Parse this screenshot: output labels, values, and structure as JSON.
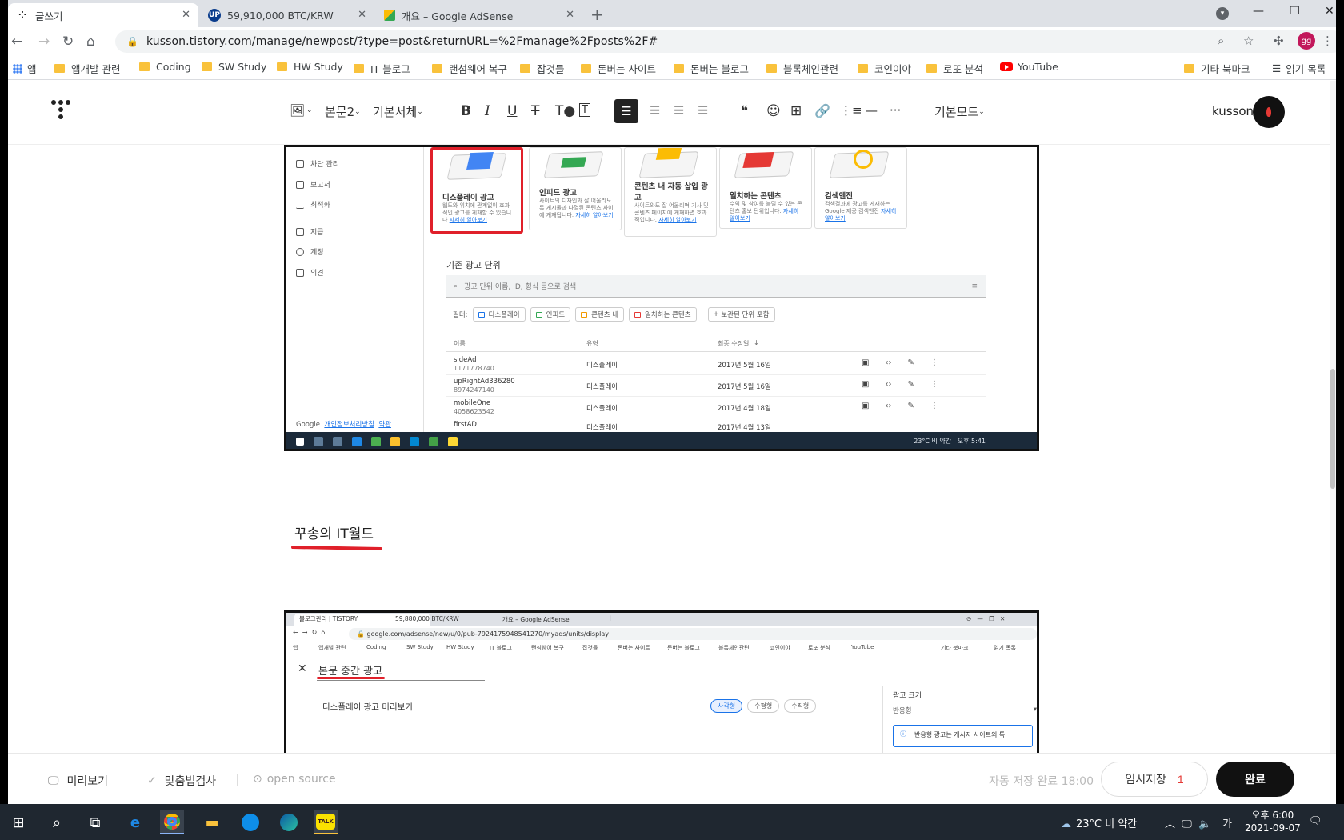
{
  "browser": {
    "tabs": [
      {
        "title": "글쓰기",
        "active": true
      },
      {
        "title": "59,910,000 BTC/KRW",
        "active": false
      },
      {
        "title": "개요 – Google AdSense",
        "active": false
      }
    ],
    "url": "kusson.tistory.com/manage/newpost/?type=post&returnURL=%2Fmanage%2Fposts%2F#",
    "profile_initials": "gg",
    "bookmarks": [
      "앱",
      "앱개발 관련",
      "Coding",
      "SW Study",
      "HW Study",
      "IT 블로그",
      "랜섬웨어 복구",
      "잡것들",
      "돈버는 사이트",
      "돈버는 블로그",
      "블록체인관련",
      "코인이야",
      "로또 분석",
      "YouTube"
    ],
    "bookmarks_right": [
      "기타 북마크",
      "읽기 목록"
    ]
  },
  "editor": {
    "toolbar": {
      "paragraph_style": "본문2",
      "font": "기본서체",
      "bold": "B",
      "italic": "I",
      "underline": "U",
      "strike": "T",
      "mode": "기본모드"
    },
    "user": {
      "name": "kusson"
    },
    "heading_text": "꾸송의 IT월드"
  },
  "screenshot1": {
    "sidebar": [
      "차단 관리",
      "보고서",
      "최적화",
      "지급",
      "계정",
      "의견"
    ],
    "footer": {
      "google": "Google",
      "privacy": "개인정보처리방침",
      "terms": "약관"
    },
    "cards": [
      {
        "title": "디스플레이 광고",
        "desc": "웹도와 위치에 관계없이 효과적인 광고를 게재할 수 있습니다",
        "link": "자세히 알아보기"
      },
      {
        "title": "인피드 광고",
        "desc": "사이트의 디자인과 잘 어울리도록 게시물과 나열된 콘텐츠 사이에 게재됩니다.",
        "link": "자세히 알아보기"
      },
      {
        "title": "콘텐츠 내 자동 삽입 광고",
        "desc": "사이트와도 잘 어울리며 기사 및 콘텐츠 페이지에 게재하면 효과적입니다.",
        "link": "자세히 알아보기"
      },
      {
        "title": "일치하는 콘텐츠",
        "desc": "수익 및 참여를 늘릴 수 있는 콘텐츠 홍보 단위입니다.",
        "link": "자세히 알아보기"
      },
      {
        "title": "검색엔진",
        "desc": "검색결과에 광고를 게재하는 Google 제공 검색엔진",
        "link": "자세히 알아보기"
      }
    ],
    "section_title": "기존 광고 단위",
    "search_placeholder": "광고 단위 이름, ID, 형식 등으로 검색",
    "filter_label": "필터:",
    "filters": [
      "디스플레이",
      "인피드",
      "콘텐츠 내",
      "일치하는 콘텐츠"
    ],
    "filter_add": "보관된 단위 포함",
    "columns": [
      "이름",
      "유형",
      "최종 수정일"
    ],
    "rows": [
      {
        "name": "sideAd",
        "id": "1171778740",
        "type": "디스플레이",
        "date": "2017년 5월 16일"
      },
      {
        "name": "upRightAd336280",
        "id": "8974247140",
        "type": "디스플레이",
        "date": "2017년 5월 16일"
      },
      {
        "name": "mobileOne",
        "id": "4058623542",
        "type": "디스플레이",
        "date": "2017년 4월 18일"
      },
      {
        "name": "firstAD",
        "id": "",
        "type": "디스플레이",
        "date": "2017년 4월 13일"
      }
    ],
    "tray": "23°C 비 약간",
    "clock": "오후 5:41"
  },
  "screenshot2": {
    "tabs": [
      "블로그관리 | TISTORY",
      "59,880,000 BTC/KRW",
      "개요 – Google AdSense"
    ],
    "url": "google.com/adsense/new/u/0/pub-7924175948541270/myads/units/display",
    "bookmarks": [
      "앱",
      "앱개발 관련",
      "Coding",
      "SW Study",
      "HW Study",
      "IT 블로그",
      "랜섬웨어 복구",
      "잡것들",
      "돈버는 사이트",
      "돈버는 블로그",
      "블록체인관련",
      "코인이야",
      "로또 분석",
      "YouTube",
      "기타 북마크",
      "읽기 목록"
    ],
    "title": "본문 중간 광고",
    "preview_label": "디스플레이 광고 미리보기",
    "shapes": [
      "사각형",
      "수평형",
      "수직형"
    ],
    "size_label": "광고 크기",
    "size_value": "반응형",
    "info_text": "반응형 광고는 게시자 사이트의 특"
  },
  "bottombar": {
    "preview": "미리보기",
    "spellcheck": "맞춤법검사",
    "open_source": "open source",
    "autosave": "자동 저장 완료 18:00",
    "temp_save": "임시저장",
    "temp_count": "1",
    "done": "완료"
  },
  "taskbar": {
    "weather": "23°C 비 약간",
    "ime": "가",
    "time": "오후 6:00",
    "date": "2021-09-07"
  }
}
